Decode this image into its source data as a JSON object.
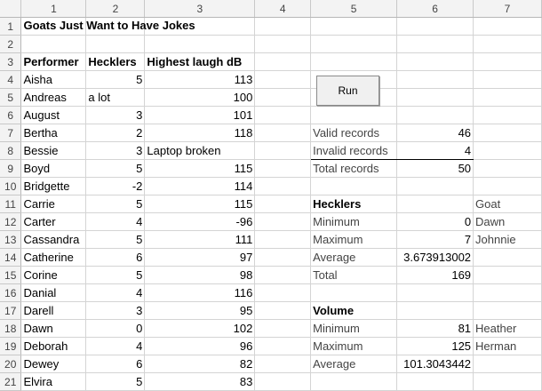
{
  "columns": [
    "1",
    "2",
    "3",
    "4",
    "5",
    "6",
    "7"
  ],
  "rows": [
    "1",
    "2",
    "3",
    "4",
    "5",
    "6",
    "7",
    "8",
    "9",
    "10",
    "11",
    "12",
    "13",
    "14",
    "15",
    "16",
    "17",
    "18",
    "19",
    "20",
    "21"
  ],
  "title": "Goats Just Want to Have Jokes",
  "headers": {
    "performer": "Performer",
    "hecklers": "Hecklers",
    "laugh": "Highest laugh dB"
  },
  "data_rows": [
    {
      "performer": "Aisha",
      "hecklers": "5",
      "laugh": "113",
      "note": ""
    },
    {
      "performer": "Andreas",
      "hecklers": "a lot",
      "laugh": "100",
      "note": ""
    },
    {
      "performer": "August",
      "hecklers": "3",
      "laugh": "101",
      "note": ""
    },
    {
      "performer": "Bertha",
      "hecklers": "2",
      "laugh": "118",
      "note": ""
    },
    {
      "performer": "Bessie",
      "hecklers": "3",
      "laugh": "",
      "note": "Laptop broken"
    },
    {
      "performer": "Boyd",
      "hecklers": "5",
      "laugh": "115",
      "note": ""
    },
    {
      "performer": "Bridgette",
      "hecklers": "-2",
      "laugh": "114",
      "note": ""
    },
    {
      "performer": "Carrie",
      "hecklers": "5",
      "laugh": "115",
      "note": ""
    },
    {
      "performer": "Carter",
      "hecklers": "4",
      "laugh": "-96",
      "note": ""
    },
    {
      "performer": "Cassandra",
      "hecklers": "5",
      "laugh": "111",
      "note": ""
    },
    {
      "performer": "Catherine",
      "hecklers": "6",
      "laugh": "97",
      "note": ""
    },
    {
      "performer": "Corine",
      "hecklers": "5",
      "laugh": "98",
      "note": ""
    },
    {
      "performer": "Danial",
      "hecklers": "4",
      "laugh": "116",
      "note": ""
    },
    {
      "performer": "Darell",
      "hecklers": "3",
      "laugh": "95",
      "note": ""
    },
    {
      "performer": "Dawn",
      "hecklers": "0",
      "laugh": "102",
      "note": ""
    },
    {
      "performer": "Deborah",
      "hecklers": "4",
      "laugh": "96",
      "note": ""
    },
    {
      "performer": "Dewey",
      "hecklers": "6",
      "laugh": "82",
      "note": ""
    },
    {
      "performer": "Elvira",
      "hecklers": "5",
      "laugh": "83",
      "note": ""
    }
  ],
  "button": {
    "label": "Run"
  },
  "summary": {
    "valid_label": "Valid records",
    "valid_value": "46",
    "invalid_label": "Invalid records",
    "invalid_value": "4",
    "total_label": "Total records",
    "total_value": "50"
  },
  "hecklers_stats": {
    "heading": "Hecklers",
    "goat_heading": "Goat",
    "min_label": "Minimum",
    "min_value": "0",
    "min_goat": "Dawn",
    "max_label": "Maximum",
    "max_value": "7",
    "max_goat": "Johnnie",
    "avg_label": "Average",
    "avg_value": "3.673913002",
    "total_label": "Total",
    "total_value": "169"
  },
  "volume_stats": {
    "heading": "Volume",
    "min_label": "Minimum",
    "min_value": "81",
    "min_goat": "Heather",
    "max_label": "Maximum",
    "max_value": "125",
    "max_goat": "Herman",
    "avg_label": "Average",
    "avg_value": "101.3043442"
  }
}
